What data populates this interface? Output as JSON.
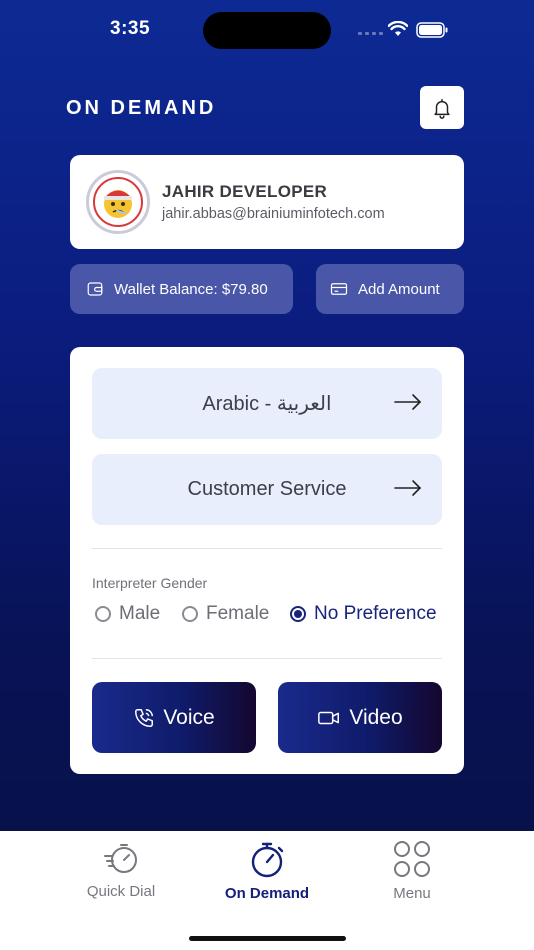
{
  "status_bar": {
    "time": "3:35"
  },
  "header": {
    "title": "ON DEMAND",
    "bell_icon": "bell-icon"
  },
  "profile": {
    "name": "JAHIR DEVELOPER",
    "email": "jahir.abbas@brainiuminfotech.com"
  },
  "wallet": {
    "balance_label": "Wallet Balance: $79.80",
    "add_label": "Add Amount"
  },
  "selection": {
    "language": "Arabic - العربية",
    "service": "Customer Service"
  },
  "gender": {
    "label": "Interpreter Gender",
    "options": [
      "Male",
      "Female",
      "No Preference"
    ],
    "selected": "No Preference"
  },
  "actions": {
    "voice": "Voice",
    "video": "Video"
  },
  "tabs": [
    {
      "label": "Quick Dial",
      "icon": "quick-dial-icon",
      "active": false
    },
    {
      "label": "On Demand",
      "icon": "stopwatch-icon",
      "active": true
    },
    {
      "label": "Menu",
      "icon": "menu-grid-icon",
      "active": false
    }
  ],
  "colors": {
    "background_top": "#0d2a94",
    "background_bottom": "#07114a",
    "accent": "#14207a",
    "tile": "#e9eefc",
    "wallet_button": "#4a57a8"
  }
}
